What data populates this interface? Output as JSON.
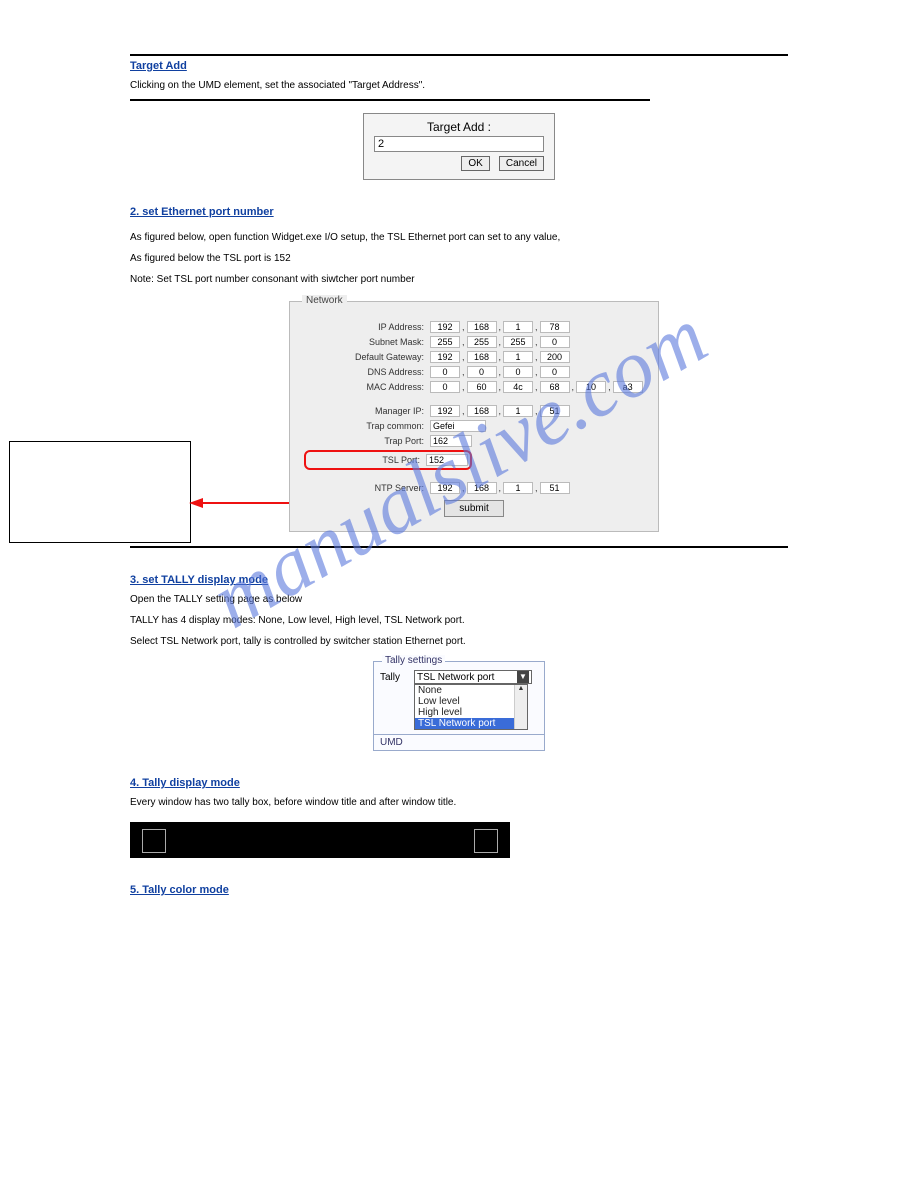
{
  "watermark": "manualslive.com",
  "section1": {
    "title": "Target Add",
    "body": "Clicking on the UMD element, set the associated \"Target Address\"."
  },
  "targetDialog": {
    "label": "Target Add   :",
    "value": "2",
    "ok": "OK",
    "cancel": "Cancel"
  },
  "section2": {
    "title": "2. set Ethernet port number",
    "body1": "As figured below, open function Widget.exe I/O setup, the TSL Ethernet port can set to any value,",
    "body2": "As figured below the TSL port is 152",
    "note": "Note: Set TSL port number consonant with siwtcher port number"
  },
  "network": {
    "legend": "Network",
    "rows": {
      "ip": {
        "label": "IP Address:",
        "o": [
          "192",
          "168",
          "1",
          "78"
        ]
      },
      "mask": {
        "label": "Subnet Mask:",
        "o": [
          "255",
          "255",
          "255",
          "0"
        ]
      },
      "gw": {
        "label": "Default Gateway:",
        "o": [
          "192",
          "168",
          "1",
          "200"
        ]
      },
      "dns": {
        "label": "DNS Address:",
        "o": [
          "0",
          "0",
          "0",
          "0"
        ]
      },
      "mac": {
        "label": "MAC Address:",
        "o": [
          "0",
          "60",
          "4c",
          "68",
          "10",
          "a3"
        ]
      },
      "mgr": {
        "label": "Manager IP:",
        "o": [
          "192",
          "168",
          "1",
          "51"
        ]
      },
      "trapc": {
        "label": "Trap common:",
        "v": "Gefei"
      },
      "trapp": {
        "label": "Trap Port:",
        "v": "162"
      },
      "tsl": {
        "label": "TSL Port:",
        "v": "152"
      },
      "ntp": {
        "label": "NTP Server:",
        "o": [
          "192",
          "168",
          "1",
          "51"
        ]
      }
    },
    "submit": "submit"
  },
  "section3": {
    "title": "3. set TALLY display mode",
    "body1": "Open the TALLY setting page as below",
    "body2": "TALLY has 4 display modes: None, Low level, High level, TSL Network port.",
    "body3": "Select TSL Network port, tally is controlled by switcher station Ethernet port."
  },
  "tally": {
    "legend": "Tally settings",
    "label": "Tally",
    "selected": "TSL Network port",
    "options": [
      "None",
      "Low level",
      "High level",
      "TSL Network port"
    ],
    "umdLabel": "UMD"
  },
  "section4": {
    "title": "4. Tally display mode",
    "body": "Every window has two tally box, before window title and after window title."
  },
  "section5": {
    "title": "5. Tally color mode"
  }
}
